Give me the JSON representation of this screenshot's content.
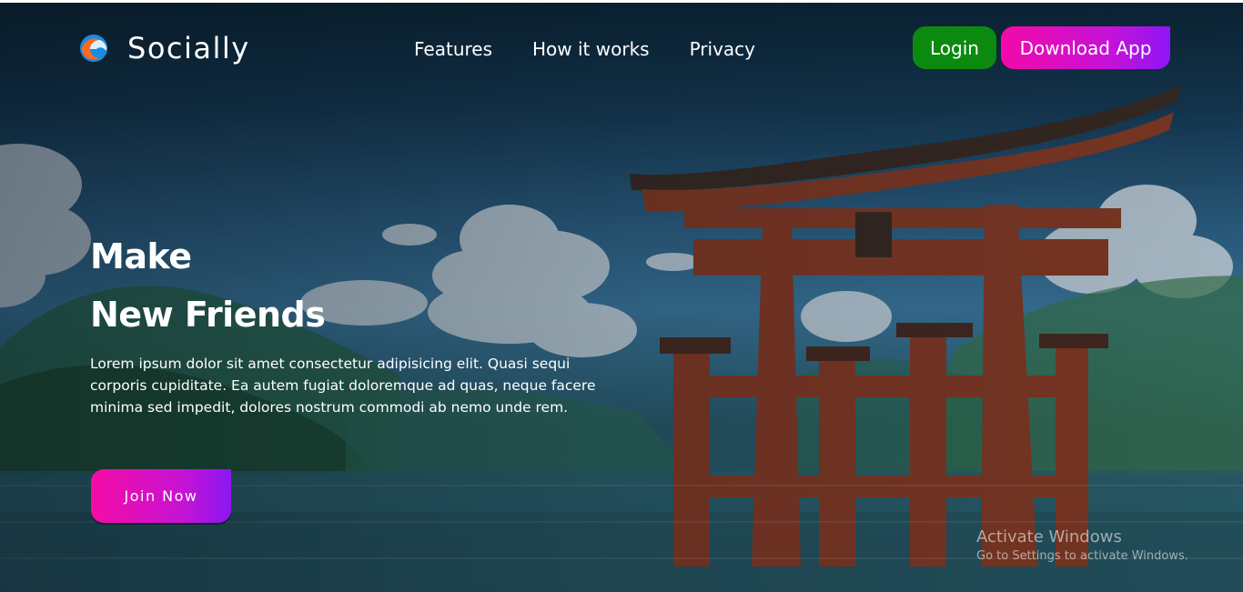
{
  "brand": {
    "name": "Socially",
    "logo_icon": "wave-logo-icon"
  },
  "nav": {
    "links": [
      "Features",
      "How it works",
      "Privacy"
    ],
    "login_label": "Login",
    "download_label": "Download App"
  },
  "hero": {
    "title_line1": "Make",
    "title_line2": "New Friends",
    "description": "Lorem ipsum dolor sit amet consectetur adipisicing elit. Quasi sequi corporis cupiditate. Ea autem fugiat doloremque ad quas, neque facere minima sed impedit, dolores nostrum commodi ab nemo unde rem.",
    "cta_label": "Join Now",
    "background": "torii-gate-in-water-landscape"
  },
  "watermark": {
    "title": "Activate Windows",
    "subtitle": "Go to Settings to activate Windows."
  },
  "colors": {
    "login_button": "#0c8a10",
    "gradient_start": "#f20aa8",
    "gradient_end": "#8d16f5",
    "text": "#ffffff"
  }
}
